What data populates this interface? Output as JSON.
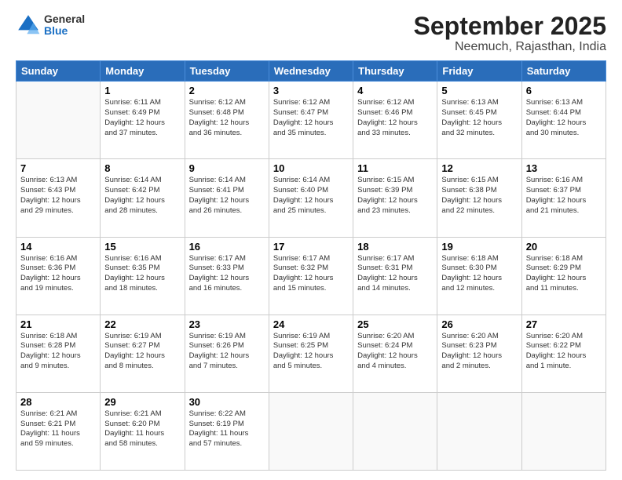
{
  "logo": {
    "general": "General",
    "blue": "Blue"
  },
  "title": "September 2025",
  "subtitle": "Neemuch, Rajasthan, India",
  "days_header": [
    "Sunday",
    "Monday",
    "Tuesday",
    "Wednesday",
    "Thursday",
    "Friday",
    "Saturday"
  ],
  "weeks": [
    [
      {
        "day": "",
        "info": ""
      },
      {
        "day": "1",
        "info": "Sunrise: 6:11 AM\nSunset: 6:49 PM\nDaylight: 12 hours\nand 37 minutes."
      },
      {
        "day": "2",
        "info": "Sunrise: 6:12 AM\nSunset: 6:48 PM\nDaylight: 12 hours\nand 36 minutes."
      },
      {
        "day": "3",
        "info": "Sunrise: 6:12 AM\nSunset: 6:47 PM\nDaylight: 12 hours\nand 35 minutes."
      },
      {
        "day": "4",
        "info": "Sunrise: 6:12 AM\nSunset: 6:46 PM\nDaylight: 12 hours\nand 33 minutes."
      },
      {
        "day": "5",
        "info": "Sunrise: 6:13 AM\nSunset: 6:45 PM\nDaylight: 12 hours\nand 32 minutes."
      },
      {
        "day": "6",
        "info": "Sunrise: 6:13 AM\nSunset: 6:44 PM\nDaylight: 12 hours\nand 30 minutes."
      }
    ],
    [
      {
        "day": "7",
        "info": "Sunrise: 6:13 AM\nSunset: 6:43 PM\nDaylight: 12 hours\nand 29 minutes."
      },
      {
        "day": "8",
        "info": "Sunrise: 6:14 AM\nSunset: 6:42 PM\nDaylight: 12 hours\nand 28 minutes."
      },
      {
        "day": "9",
        "info": "Sunrise: 6:14 AM\nSunset: 6:41 PM\nDaylight: 12 hours\nand 26 minutes."
      },
      {
        "day": "10",
        "info": "Sunrise: 6:14 AM\nSunset: 6:40 PM\nDaylight: 12 hours\nand 25 minutes."
      },
      {
        "day": "11",
        "info": "Sunrise: 6:15 AM\nSunset: 6:39 PM\nDaylight: 12 hours\nand 23 minutes."
      },
      {
        "day": "12",
        "info": "Sunrise: 6:15 AM\nSunset: 6:38 PM\nDaylight: 12 hours\nand 22 minutes."
      },
      {
        "day": "13",
        "info": "Sunrise: 6:16 AM\nSunset: 6:37 PM\nDaylight: 12 hours\nand 21 minutes."
      }
    ],
    [
      {
        "day": "14",
        "info": "Sunrise: 6:16 AM\nSunset: 6:36 PM\nDaylight: 12 hours\nand 19 minutes."
      },
      {
        "day": "15",
        "info": "Sunrise: 6:16 AM\nSunset: 6:35 PM\nDaylight: 12 hours\nand 18 minutes."
      },
      {
        "day": "16",
        "info": "Sunrise: 6:17 AM\nSunset: 6:33 PM\nDaylight: 12 hours\nand 16 minutes."
      },
      {
        "day": "17",
        "info": "Sunrise: 6:17 AM\nSunset: 6:32 PM\nDaylight: 12 hours\nand 15 minutes."
      },
      {
        "day": "18",
        "info": "Sunrise: 6:17 AM\nSunset: 6:31 PM\nDaylight: 12 hours\nand 14 minutes."
      },
      {
        "day": "19",
        "info": "Sunrise: 6:18 AM\nSunset: 6:30 PM\nDaylight: 12 hours\nand 12 minutes."
      },
      {
        "day": "20",
        "info": "Sunrise: 6:18 AM\nSunset: 6:29 PM\nDaylight: 12 hours\nand 11 minutes."
      }
    ],
    [
      {
        "day": "21",
        "info": "Sunrise: 6:18 AM\nSunset: 6:28 PM\nDaylight: 12 hours\nand 9 minutes."
      },
      {
        "day": "22",
        "info": "Sunrise: 6:19 AM\nSunset: 6:27 PM\nDaylight: 12 hours\nand 8 minutes."
      },
      {
        "day": "23",
        "info": "Sunrise: 6:19 AM\nSunset: 6:26 PM\nDaylight: 12 hours\nand 7 minutes."
      },
      {
        "day": "24",
        "info": "Sunrise: 6:19 AM\nSunset: 6:25 PM\nDaylight: 12 hours\nand 5 minutes."
      },
      {
        "day": "25",
        "info": "Sunrise: 6:20 AM\nSunset: 6:24 PM\nDaylight: 12 hours\nand 4 minutes."
      },
      {
        "day": "26",
        "info": "Sunrise: 6:20 AM\nSunset: 6:23 PM\nDaylight: 12 hours\nand 2 minutes."
      },
      {
        "day": "27",
        "info": "Sunrise: 6:20 AM\nSunset: 6:22 PM\nDaylight: 12 hours\nand 1 minute."
      }
    ],
    [
      {
        "day": "28",
        "info": "Sunrise: 6:21 AM\nSunset: 6:21 PM\nDaylight: 11 hours\nand 59 minutes."
      },
      {
        "day": "29",
        "info": "Sunrise: 6:21 AM\nSunset: 6:20 PM\nDaylight: 11 hours\nand 58 minutes."
      },
      {
        "day": "30",
        "info": "Sunrise: 6:22 AM\nSunset: 6:19 PM\nDaylight: 11 hours\nand 57 minutes."
      },
      {
        "day": "",
        "info": ""
      },
      {
        "day": "",
        "info": ""
      },
      {
        "day": "",
        "info": ""
      },
      {
        "day": "",
        "info": ""
      }
    ]
  ]
}
